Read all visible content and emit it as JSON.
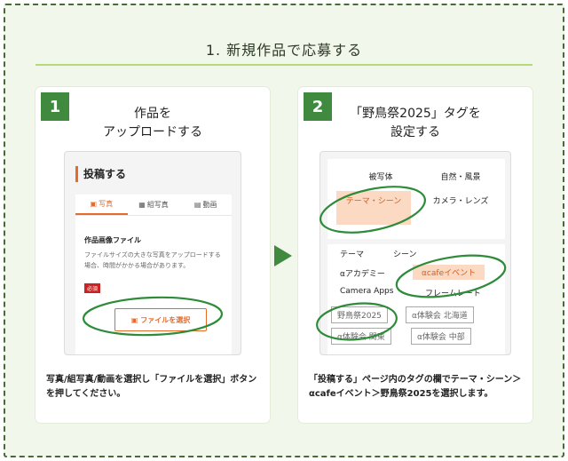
{
  "page": {
    "heading": "1. 新規作品で応募する",
    "accent_color": "#3f8a3f",
    "highlight_color": "#e46b2b"
  },
  "step1": {
    "number": "1",
    "title": "作品を\nアップロードする",
    "mock": {
      "header": "投稿する",
      "tabs": [
        {
          "icon": "photo-icon",
          "label": "写真"
        },
        {
          "icon": "grid-icon",
          "label": "組写真"
        },
        {
          "icon": "film-icon",
          "label": "動画"
        }
      ],
      "file_label": "作品画像ファイル",
      "note": "ファイルサイズの大きな写真をアップロードする場合、時間がかかる場合があります。",
      "required_badge": "必須",
      "file_button": "ファイルを選択"
    },
    "description": "写真/組写真/動画を選択し「ファイルを選択」ボタンを押してください。"
  },
  "step2": {
    "number": "2",
    "title": "「野鳥祭2025」タグを\n設定する",
    "mock": {
      "categories": [
        "被写体",
        "自然・風景",
        "テーマ・シーン",
        "カメラ・レンズ"
      ],
      "tags_row1": [
        "テーマ",
        "シーン"
      ],
      "tag_academy": "αアカデミー",
      "tag_cafe_event": "αcafeイベント",
      "tag_camera_apps": "Camera Apps",
      "tag_frame": "フレームレート",
      "tag_yachou": "野鳥祭2025",
      "tag_hokkaido": "α体験会 北海道",
      "tag_kanto": "α体験会 関東",
      "tag_chubu": "α体験会 中部"
    },
    "description": "「投稿する」ページ内のタグの欄でテーマ・シーン＞αcafeイベント＞野鳥祭2025を選択します。"
  }
}
